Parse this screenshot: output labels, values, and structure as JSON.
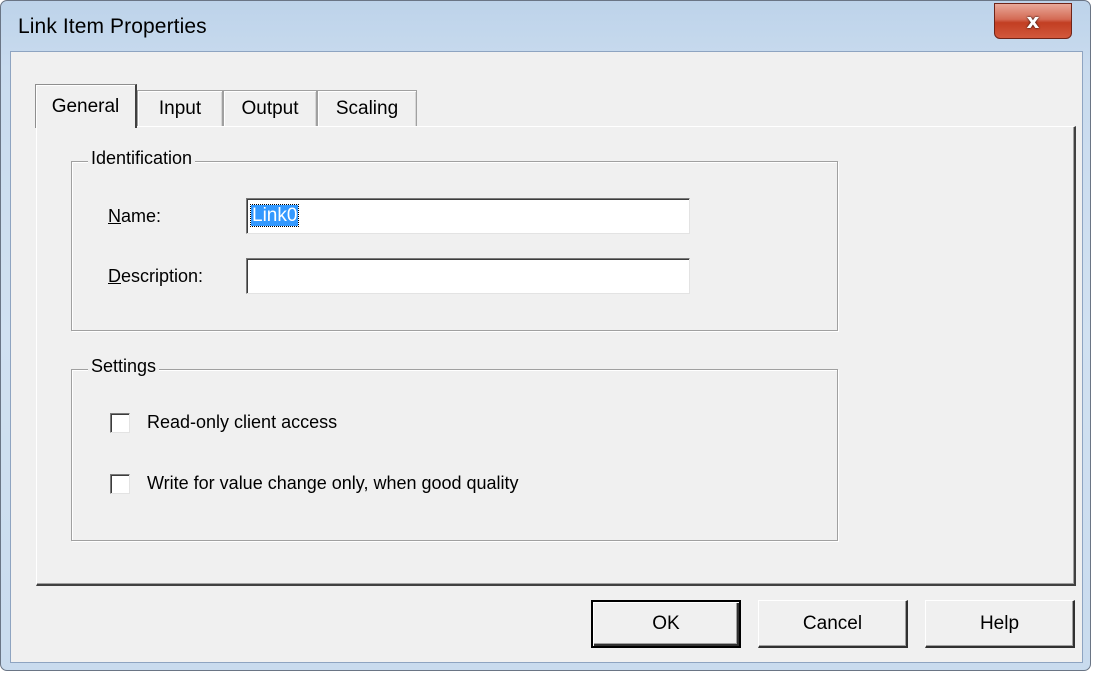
{
  "window": {
    "title": "Link Item Properties",
    "close_label": "x"
  },
  "tabs": [
    {
      "label": "General",
      "active": true
    },
    {
      "label": "Input",
      "active": false
    },
    {
      "label": "Output",
      "active": false
    },
    {
      "label": "Scaling",
      "active": false
    }
  ],
  "identification": {
    "title": "Identification",
    "name_label_first": "N",
    "name_label_rest": "ame:",
    "name_value": "Link0",
    "description_label_first": "D",
    "description_label_rest": "escription:",
    "description_value": ""
  },
  "settings": {
    "title": "Settings",
    "readonly_label": "Read-only client access",
    "readonly_checked": false,
    "write_label": "Write for value change only, when good quality",
    "write_checked": false
  },
  "buttons": {
    "ok": "OK",
    "cancel": "Cancel",
    "help": "Help"
  }
}
